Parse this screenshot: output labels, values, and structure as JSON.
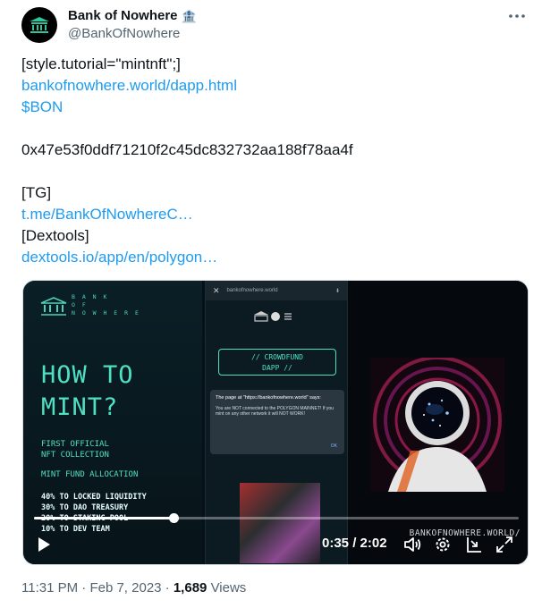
{
  "author": {
    "name": "Bank of Nowhere",
    "handle": "@BankOfNowhere",
    "name_emoji": "🏦"
  },
  "tweet": {
    "lines": [
      {
        "text": "[style.tutorial=\"mintnft\";]",
        "link": false
      },
      {
        "text": "bankofnowhere.world/dapp.html",
        "link": true
      },
      {
        "text": "$BON",
        "link": true
      },
      {
        "text": "",
        "link": false
      },
      {
        "text": "0x47e53f0ddf71210f2c45dc832732aa188f78aa4f",
        "link": false
      },
      {
        "text": "",
        "link": false
      },
      {
        "text": "[TG]",
        "link": false
      },
      {
        "text": "t.me/BankOfNowhereC…",
        "link": true
      },
      {
        "text": "[Dextools]",
        "link": false
      },
      {
        "text": "dextools.io/app/en/polygon…",
        "link": true
      }
    ]
  },
  "video": {
    "logo_text": [
      "B A N K",
      "O F",
      "N O W H E R E"
    ],
    "headline": [
      "HOW TO",
      "MINT?"
    ],
    "collection": [
      "FIRST OFFICIAL",
      "NFT COLLECTION"
    ],
    "fund_allocation": "MINT FUND ALLOCATION",
    "allocations": [
      "40% TO LOCKED LIQUIDITY",
      "30% TO DAO TREASURY",
      "20% TO STAKING POOL",
      "10% TO DEV TEAM"
    ],
    "phone_url": "bankofnowhere.world",
    "crowdfund": [
      "// CROWDFUND",
      "DAPP //"
    ],
    "dialog_title": "The page at \"https://bankofnowhere.world\" says:",
    "dialog_body": "You are NOT connected to the POLYGON MAINNET! If you mint on any other network it will NOT WORK!",
    "dialog_ok": "OK",
    "site_text": "BANKOFNOWHERE.WORLD/",
    "current_time": "0:35",
    "duration": "2:02",
    "time_display": "0:35 / 2:02",
    "progress_fraction": 0.287
  },
  "meta": {
    "time": "11:31 PM",
    "date": "Feb 7, 2023",
    "views_count": "1,689",
    "views_label": "Views",
    "separator": "·"
  },
  "colors": {
    "link": "#1d9bf0",
    "secondary_text": "#536471",
    "accent_teal": "#4fe0c4"
  },
  "icons": {
    "more": "more-horizontal-icon",
    "play": "play-icon",
    "volume": "volume-icon",
    "settings": "gear-icon",
    "pip": "picture-in-picture-icon",
    "fullscreen": "fullscreen-icon"
  }
}
